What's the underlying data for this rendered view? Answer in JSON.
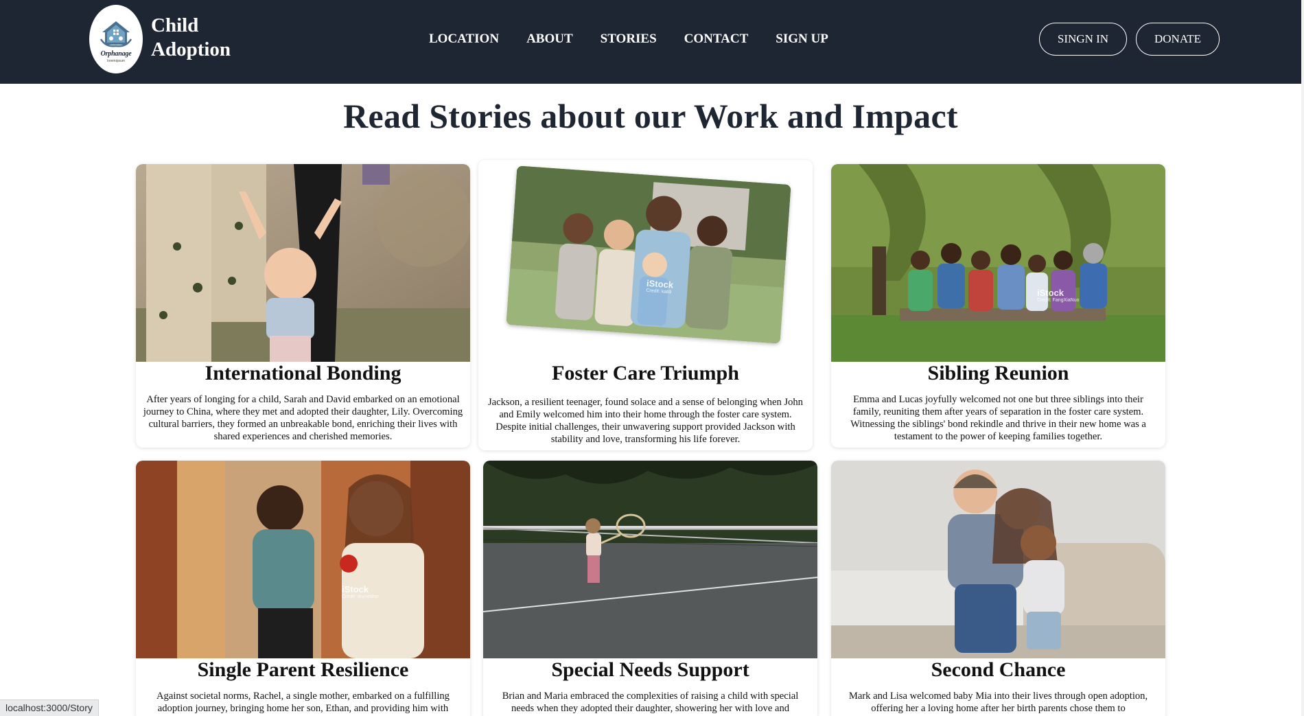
{
  "header": {
    "logo_word": "Orphanage",
    "logo_sub": "loremipsum",
    "brand_line1": "Child",
    "brand_line2": "Adoption",
    "nav": [
      "LOCATION",
      "ABOUT",
      "STORIES",
      "CONTACT",
      "SIGN UP"
    ],
    "signin_label": "SINGN IN",
    "donate_label": "DONATE"
  },
  "main": {
    "title": "Read Stories about our Work and Impact",
    "cards": [
      {
        "title": "International Bonding",
        "text": "After years of longing for a child, Sarah and David embarked on an emotional journey to China, where they met and adopted their daughter, Lily. Overcoming cultural barriers, they formed an unbreakable bond, enriching their lives with shared experiences and cherished memories."
      },
      {
        "title": "Foster Care Triumph",
        "text": "Jackson, a resilient teenager, found solace and a sense of belonging when John and Emily welcomed him into their home through the foster care system. Despite initial challenges, their unwavering support provided Jackson with stability and love, transforming his life forever.",
        "watermark": "iStock",
        "credit": "Credit: kali9"
      },
      {
        "title": "Sibling Reunion",
        "text": "Emma and Lucas joyfully welcomed not one but three siblings into their family, reuniting them after years of separation in the foster care system. Witnessing the siblings' bond rekindle and thrive in their new home was a testament to the power of keeping families together.",
        "watermark": "iStock",
        "credit": "Credit: FangXiaNuo"
      },
      {
        "title": "Single Parent Resilience",
        "text": "Against societal norms, Rachel, a single mother, embarked on a fulfilling adoption journey, bringing home her son, Ethan, and providing him with",
        "watermark": "iStock",
        "credit": "Credit: skynesher"
      },
      {
        "title": "Special Needs Support",
        "text": "Brian and Maria embraced the complexities of raising a child with special needs when they adopted their daughter, showering her with love and"
      },
      {
        "title": "Second Chance",
        "text": "Mark and Lisa welcomed baby Mia into their lives through open adoption, offering her a loving home after her birth parents chose them to"
      }
    ]
  },
  "status_url": "localhost:3000/Story",
  "colors": {
    "header_bg": "#1f2633",
    "title_text": "#1f2633",
    "white": "#ffffff"
  }
}
